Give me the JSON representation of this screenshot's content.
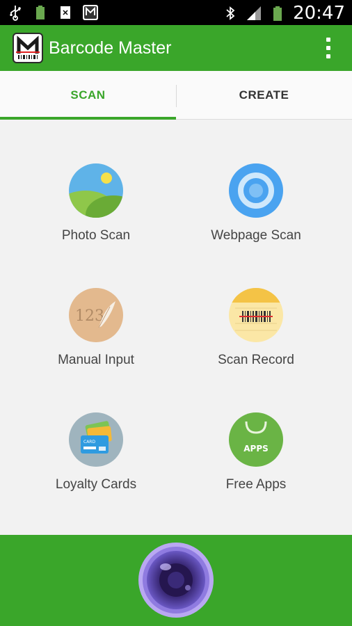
{
  "status_bar": {
    "time": "20:47",
    "icons": [
      "usb-icon",
      "battery-notification-icon",
      "download-file-icon",
      "app-notification-icon",
      "bluetooth-icon",
      "signal-icon",
      "battery-icon"
    ]
  },
  "app_bar": {
    "title": "Barcode Master",
    "menu_icon": "overflow-menu-icon"
  },
  "tabs": [
    {
      "label": "SCAN",
      "active": true
    },
    {
      "label": "CREATE",
      "active": false
    }
  ],
  "grid": [
    {
      "label": "Photo Scan",
      "icon": "photo-icon"
    },
    {
      "label": "Webpage Scan",
      "icon": "webpage-icon"
    },
    {
      "label": "Manual Input",
      "icon": "manual-input-icon"
    },
    {
      "label": "Scan Record",
      "icon": "scan-record-icon"
    },
    {
      "label": "Loyalty Cards",
      "icon": "loyalty-cards-icon"
    },
    {
      "label": "Free Apps",
      "icon": "free-apps-icon"
    }
  ],
  "icon_text": {
    "manual_input": "123",
    "card": "CARD",
    "apps": "APPS"
  },
  "colors": {
    "brand_green": "#3aa62a",
    "tab_active": "#3aa62a"
  },
  "bottom": {
    "button_icon": "camera-lens-icon"
  }
}
